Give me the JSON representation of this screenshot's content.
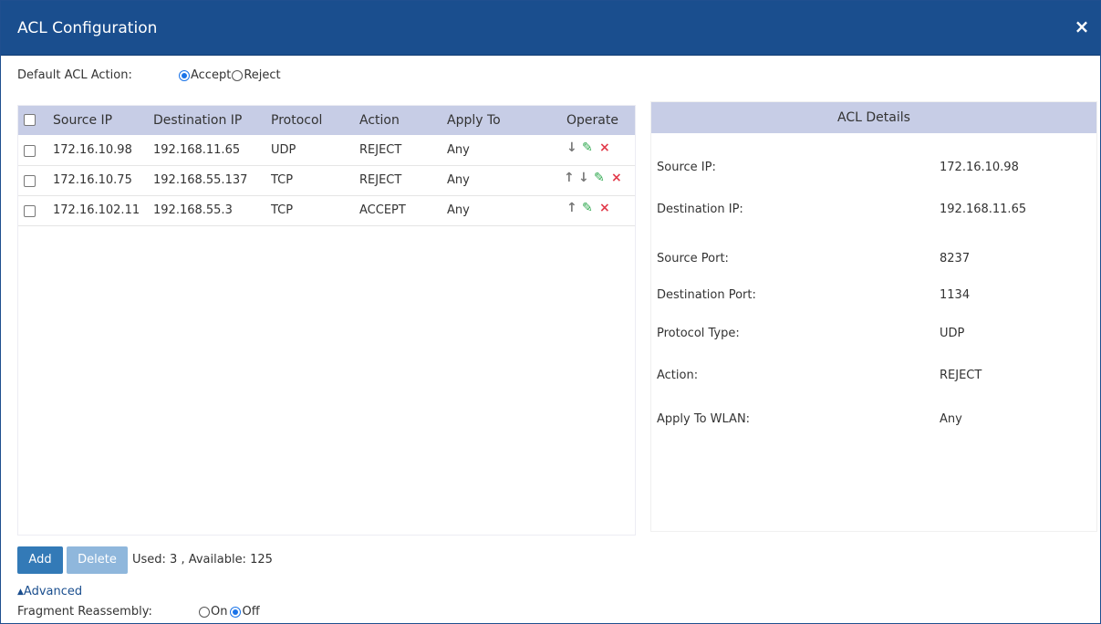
{
  "dialog": {
    "title": "ACL Configuration",
    "close_icon": "×"
  },
  "default_action": {
    "label": "Default ACL Action:",
    "options": [
      "Accept",
      "Reject"
    ],
    "selected": "Accept"
  },
  "table": {
    "headers": [
      "Source IP",
      "Destination IP",
      "Protocol",
      "Action",
      "Apply To",
      "Operate"
    ],
    "rows": [
      {
        "source_ip": "172.16.10.98",
        "destination_ip": "192.168.11.65",
        "protocol": "UDP",
        "action": "REJECT",
        "apply_to": "Any",
        "operations": [
          "move-down",
          "edit",
          "delete"
        ]
      },
      {
        "source_ip": "172.16.10.75",
        "destination_ip": "192.168.55.137",
        "protocol": "TCP",
        "action": "REJECT",
        "apply_to": "Any",
        "operations": [
          "move-up",
          "move-down",
          "edit",
          "delete"
        ]
      },
      {
        "source_ip": "172.16.102.11",
        "destination_ip": "192.168.55.3",
        "protocol": "TCP",
        "action": "ACCEPT",
        "apply_to": "Any",
        "operations": [
          "move-up",
          "edit",
          "delete"
        ]
      }
    ]
  },
  "details": {
    "title": "ACL Details",
    "fields": [
      {
        "label": "Source IP:",
        "value": "172.16.10.98"
      },
      {
        "label": "Destination IP:",
        "value": "192.168.11.65"
      },
      {
        "label": "Source Port:",
        "value": "8237"
      },
      {
        "label": "Destination Port:",
        "value": "1134"
      },
      {
        "label": "Protocol Type:",
        "value": "UDP"
      },
      {
        "label": "Action:",
        "value": "REJECT"
      },
      {
        "label": "Apply To WLAN:",
        "value": "Any"
      }
    ]
  },
  "footer": {
    "add_label": "Add",
    "delete_label": "Delete",
    "usage_text": "Used: 3 , Available: 125",
    "advanced_label": "Advanced",
    "fragment_label": "Fragment Reassembly:",
    "fragment_options": [
      "On",
      "Off"
    ],
    "fragment_selected": "Off"
  },
  "colors": {
    "titlebar": "#1a4e8e",
    "header_bg": "#c7cde6",
    "add_button": "#337ab7",
    "delete_button_disabled": "#8fb7dc",
    "edit_icon": "#2fa84f",
    "delete_icon": "#e23b4b"
  }
}
